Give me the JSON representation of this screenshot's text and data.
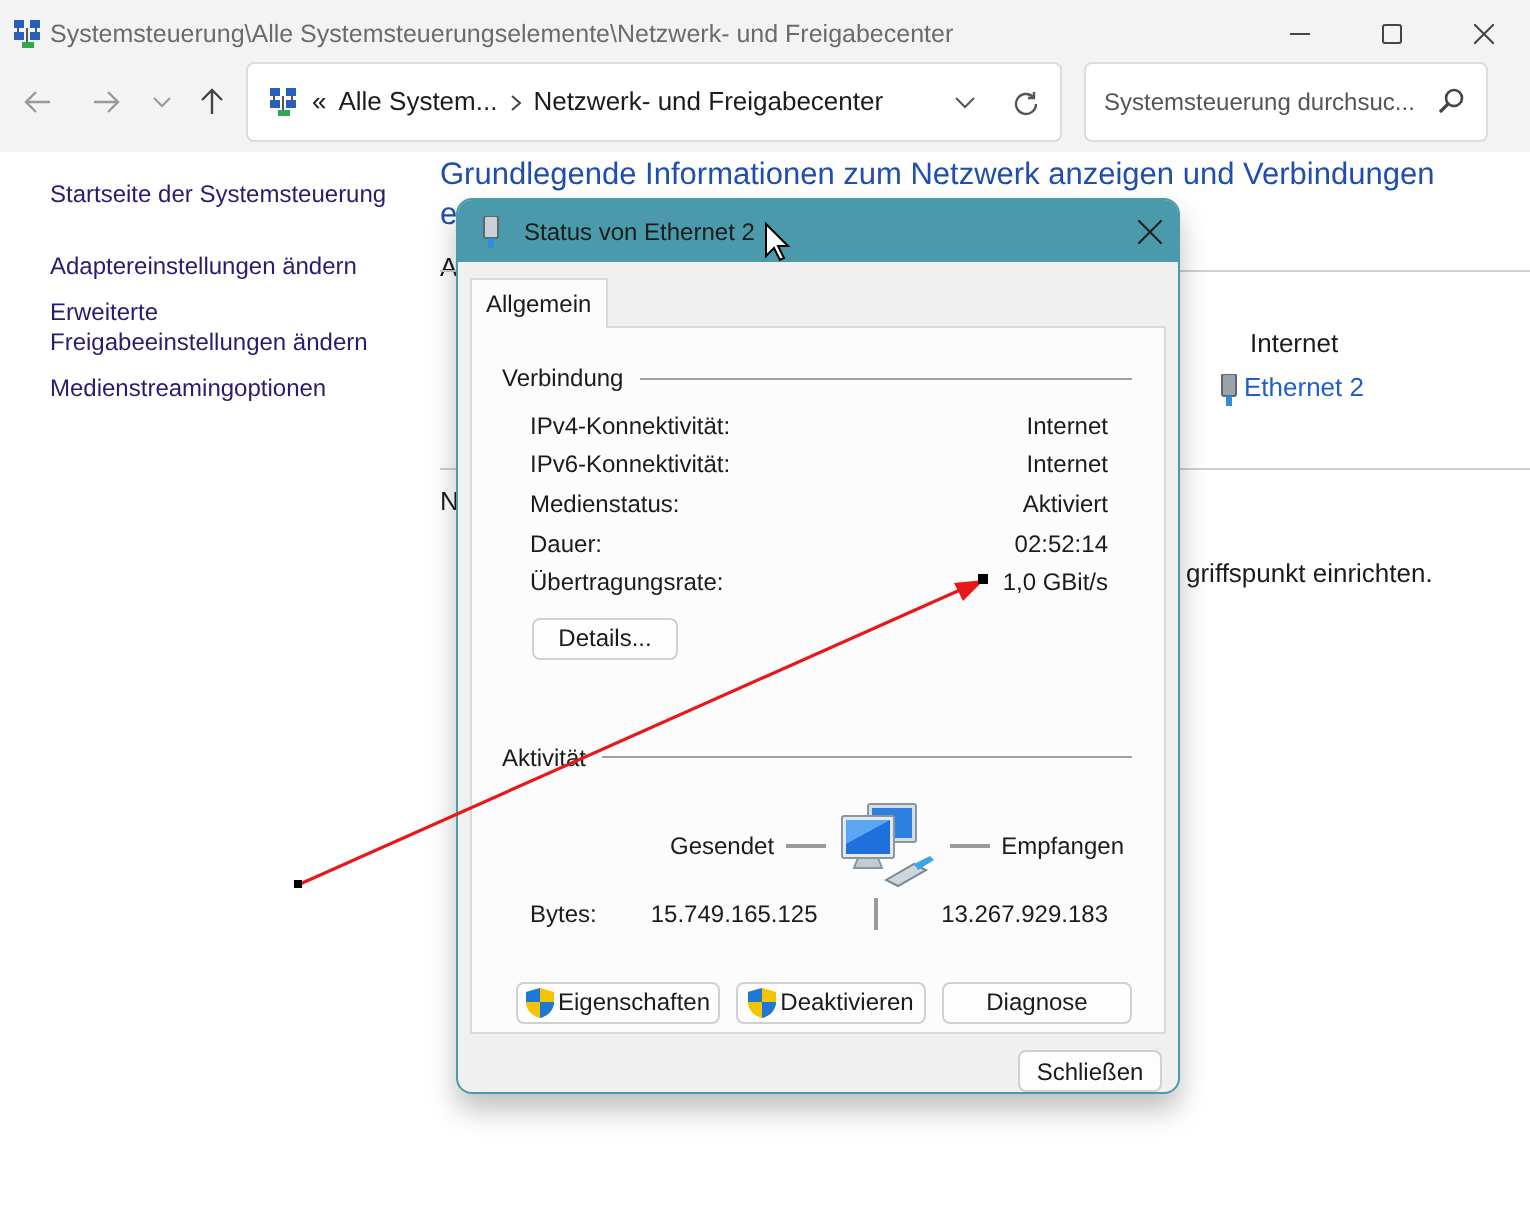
{
  "window": {
    "title": "Systemsteuerung\\Alle Systemsteuerungselemente\\Netzwerk- und Freigabecenter"
  },
  "address_bar": {
    "overflow": "«",
    "breadcrumbs": [
      "Alle System...",
      "Netzwerk- und Freigabecenter"
    ]
  },
  "search": {
    "placeholder": "Systemsteuerung durchsuc..."
  },
  "sidebar": {
    "items": [
      "Startseite der Systemsteuerung",
      "Adaptereinstellungen ändern",
      "Erweiterte\nFreigabeeinstellungen ändern",
      "Medienstreamingoptionen"
    ]
  },
  "main": {
    "heading": "Grundlegende Informationen zum Netzwerk anzeigen und Verbindungen",
    "heading_fragment": "e",
    "section_fragment_1": "A",
    "network_type": "Internet",
    "connection_link": "Ethernet 2",
    "section_fragment_2": "N",
    "text_fragment": "griffspunkt einrichten."
  },
  "dialog": {
    "title": "Status von Ethernet 2",
    "tabs": [
      {
        "label": "Allgemein",
        "selected": true
      }
    ],
    "connection": {
      "heading": "Verbindung",
      "rows": [
        {
          "label": "IPv4-Konnektivität:",
          "value": "Internet"
        },
        {
          "label": "IPv6-Konnektivität:",
          "value": "Internet"
        },
        {
          "label": "Medienstatus:",
          "value": "Aktiviert"
        },
        {
          "label": "Dauer:",
          "value": "02:52:14"
        },
        {
          "label": "Übertragungsrate:",
          "value": "1,0 GBit/s"
        }
      ]
    },
    "details_button": "Details...",
    "activity": {
      "heading": "Aktivität",
      "sent_label": "Gesendet",
      "received_label": "Empfangen",
      "bytes_label": "Bytes:",
      "sent": "15.749.165.125",
      "received": "13.267.929.183"
    },
    "buttons": [
      {
        "label": "Eigenschaften",
        "shield": true
      },
      {
        "label": "Deaktivieren",
        "shield": true
      },
      {
        "label": "Diagnose",
        "shield": false
      }
    ],
    "close_button": "Schließen"
  }
}
